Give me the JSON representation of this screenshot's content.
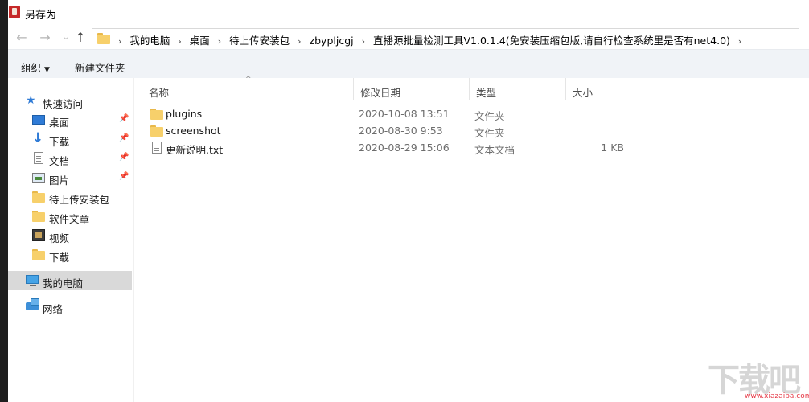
{
  "window": {
    "title": "另存为"
  },
  "address": {
    "crumbs": [
      "我的电脑",
      "桌面",
      "待上传安装包",
      "zbypljcgj",
      "直播源批量检测工具V1.0.1.4(免安装压缩包版,请自行检查系统里是否有net4.0)"
    ]
  },
  "navigation": {
    "back": "←",
    "forward": "→",
    "recent": "⌄",
    "up": "↑"
  },
  "toolbar": {
    "organize_label": "组织",
    "organize_caret": "▼",
    "new_folder_label": "新建文件夹"
  },
  "sidebar": {
    "items": [
      {
        "label": "快速访问",
        "icon": "star-icon"
      },
      {
        "label": "桌面",
        "icon": "desktop-icon",
        "pinned": true
      },
      {
        "label": "下载",
        "icon": "download-icon",
        "pinned": true
      },
      {
        "label": "文档",
        "icon": "document-icon",
        "pinned": true
      },
      {
        "label": "图片",
        "icon": "pictures-icon",
        "pinned": true
      },
      {
        "label": "待上传安装包",
        "icon": "folder-icon"
      },
      {
        "label": "软件文章",
        "icon": "folder-icon"
      },
      {
        "label": "视频",
        "icon": "video-icon"
      },
      {
        "label": "下载",
        "icon": "folder-icon"
      },
      {
        "label": "我的电脑",
        "icon": "computer-icon",
        "selected": true
      },
      {
        "label": "网络",
        "icon": "network-icon"
      }
    ],
    "pin_glyph": "📌"
  },
  "filelist": {
    "columns": {
      "name": "名称",
      "date": "修改日期",
      "type": "类型",
      "size": "大小"
    },
    "sort_arrow": "^",
    "rows": [
      {
        "name": "plugins",
        "date": "2020-10-08 13:51",
        "type": "文件夹",
        "size": "",
        "icon": "folder-icon"
      },
      {
        "name": "screenshot",
        "date": "2020-08-30 9:53",
        "type": "文件夹",
        "size": "",
        "icon": "folder-icon"
      },
      {
        "name": "更新说明.txt",
        "date": "2020-08-29 15:06",
        "type": "文本文档",
        "size": "1 KB",
        "icon": "text-file-icon"
      }
    ]
  },
  "watermark": {
    "text": "下载吧",
    "url": "www.xiazaiba.com"
  },
  "colors": {
    "folder": "#f7d06b",
    "accent": "#2f7bd6",
    "selected_bg": "#d9d9d9",
    "toolbar_bg": "#f0f3f7"
  }
}
